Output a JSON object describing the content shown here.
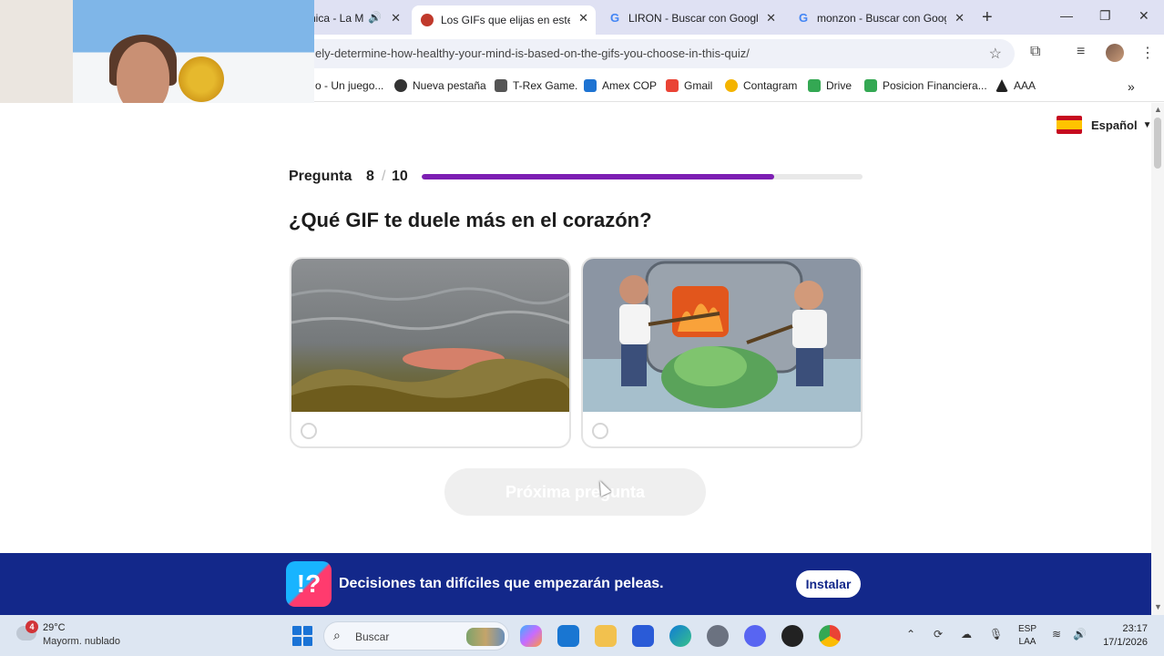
{
  "browser": {
    "tabs": [
      {
        "label": "nica - La M",
        "has_audio": true
      },
      {
        "label": "Los GIFs que elijas en este te",
        "active": true
      },
      {
        "label": "LIRON - Buscar con Google"
      },
      {
        "label": "monzon - Buscar con Googl"
      }
    ],
    "url": "ely-determine-how-healthy-your-mind-is-based-on-the-gifs-you-choose-in-this-quiz/",
    "bookmarks": [
      {
        "label": "o - Un juego...",
        "icon": "game-icon"
      },
      {
        "label": "Nueva pestaña",
        "icon": "globe-icon"
      },
      {
        "label": "T-Rex Game.",
        "icon": "dino-icon"
      },
      {
        "label": "Amex COP",
        "icon": "amex-icon"
      },
      {
        "label": "Gmail",
        "icon": "gmail-icon"
      },
      {
        "label": "Contagram",
        "icon": "contagram-icon"
      },
      {
        "label": "Drive",
        "icon": "drive-icon"
      },
      {
        "label": "Posicion Financiera...",
        "icon": "drive-icon"
      },
      {
        "label": "AAA",
        "icon": "aaa-icon"
      }
    ]
  },
  "quiz": {
    "language": "Español",
    "question_label": "Pregunta",
    "current": "8",
    "separator": "/",
    "total": "10",
    "progress_fraction": 0.8,
    "question": "¿Qué GIF te duele más en el corazón?",
    "next_button": "Próxima pregunta",
    "options": [
      {
        "image": "gif-water-wave"
      },
      {
        "image": "gif-cartoon-burning-money"
      }
    ]
  },
  "ad": {
    "logo_text": "!?",
    "text": "Decisiones tan difíciles que empezarán peleas.",
    "button": "Instalar"
  },
  "taskbar": {
    "weather_badge": "4",
    "temp": "29°C",
    "weather_desc": "Mayorm. nublado",
    "search_placeholder": "Buscar",
    "lang_top": "ESP",
    "lang_bottom": "LAA",
    "time": "23:17",
    "date": "17/1/2026"
  },
  "colors": {
    "progress": "#7d1fb3",
    "ad_bar": "#13288a",
    "tabstrip": "#dfe1f3"
  }
}
